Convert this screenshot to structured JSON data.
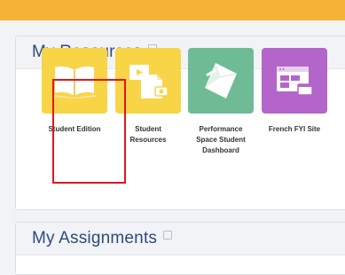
{
  "resources": {
    "title": "My Resources",
    "tiles": [
      {
        "label": "Student Edition",
        "icon": "open-book-icon",
        "color": "#f8d447"
      },
      {
        "label": "Student\nResources",
        "icon": "document-media-icon",
        "color": "#f8d447"
      },
      {
        "label": "Performance\nSpace Student\nDashboard",
        "icon": "folded-paper-icon",
        "color": "#6ebb95"
      },
      {
        "label": "French FYI Site",
        "icon": "browser-window-icon",
        "color": "#b365c9"
      }
    ]
  },
  "assignments": {
    "title": "My Assignments"
  },
  "colors": {
    "top_bar": "#f5b335",
    "highlight": "#e0161b",
    "title": "#2f4b7a"
  }
}
